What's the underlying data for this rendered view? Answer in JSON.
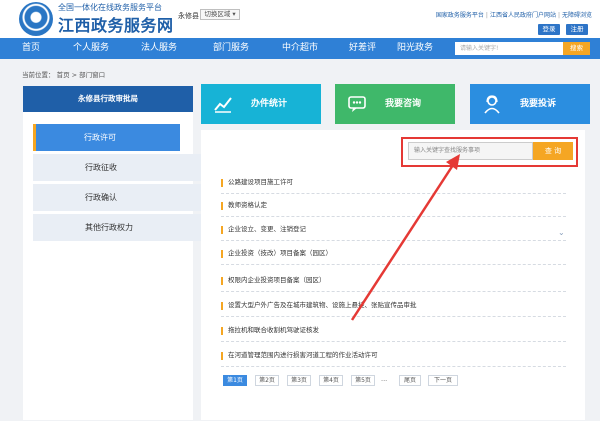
{
  "header": {
    "subtitle": "全国一体化在线政务服务平台",
    "title": "江西政务服务网",
    "region_label": "永修县",
    "region_button": "切换区域 ▾",
    "top_links": [
      "国家政务服务平台",
      "江西省人民政府门户网站",
      "无障碍浏览"
    ],
    "login": "登录",
    "register": "注册"
  },
  "nav": {
    "items": [
      "首页",
      "个人服务",
      "法人服务",
      "部门服务",
      "中介超市",
      "好差评",
      "阳光政务"
    ],
    "search_placeholder": "请输入关键字!",
    "search_button": "搜索"
  },
  "breadcrumb": "当前位置： 首页 > 部门窗口",
  "left_panel": {
    "title": "永修县行政审批局",
    "items": [
      "行政许可",
      "行政征收",
      "行政确认",
      "其他行政权力"
    ]
  },
  "tiles": [
    {
      "label": "办件统计",
      "color": "#17b3d6",
      "icon": "chart-icon"
    },
    {
      "label": "我要咨询",
      "color": "#3fb86a",
      "icon": "chat-icon"
    },
    {
      "label": "我要投诉",
      "color": "#2b8ee0",
      "icon": "support-agent-icon"
    }
  ],
  "service_search": {
    "placeholder": "输入关键字查找服务事项",
    "button": "查 询"
  },
  "services": [
    "公路建设项目施工许可",
    "教师资格认定",
    "企业设立、变更、注销登记",
    "企业投资（技改）项目备案（园区）",
    "权限内企业投资项目备案（园区）",
    "设置大型户外广告及在城市建筑物、设施上悬挂、张贴宣传品审批",
    "拖拉机和联合收割机驾驶证核发",
    "在河道管理范围内进行损害河道工程的作业活动许可"
  ],
  "pagination": {
    "pages": [
      "第1页",
      "第2页",
      "第3页",
      "第4页",
      "第5页"
    ],
    "ellipsis": "...",
    "last": "尾页",
    "next": "下一页"
  },
  "colors": {
    "brand": "#1f5fa8",
    "nav": "#2f80d6",
    "accent": "#f5a623",
    "highlight": "#e53935"
  }
}
